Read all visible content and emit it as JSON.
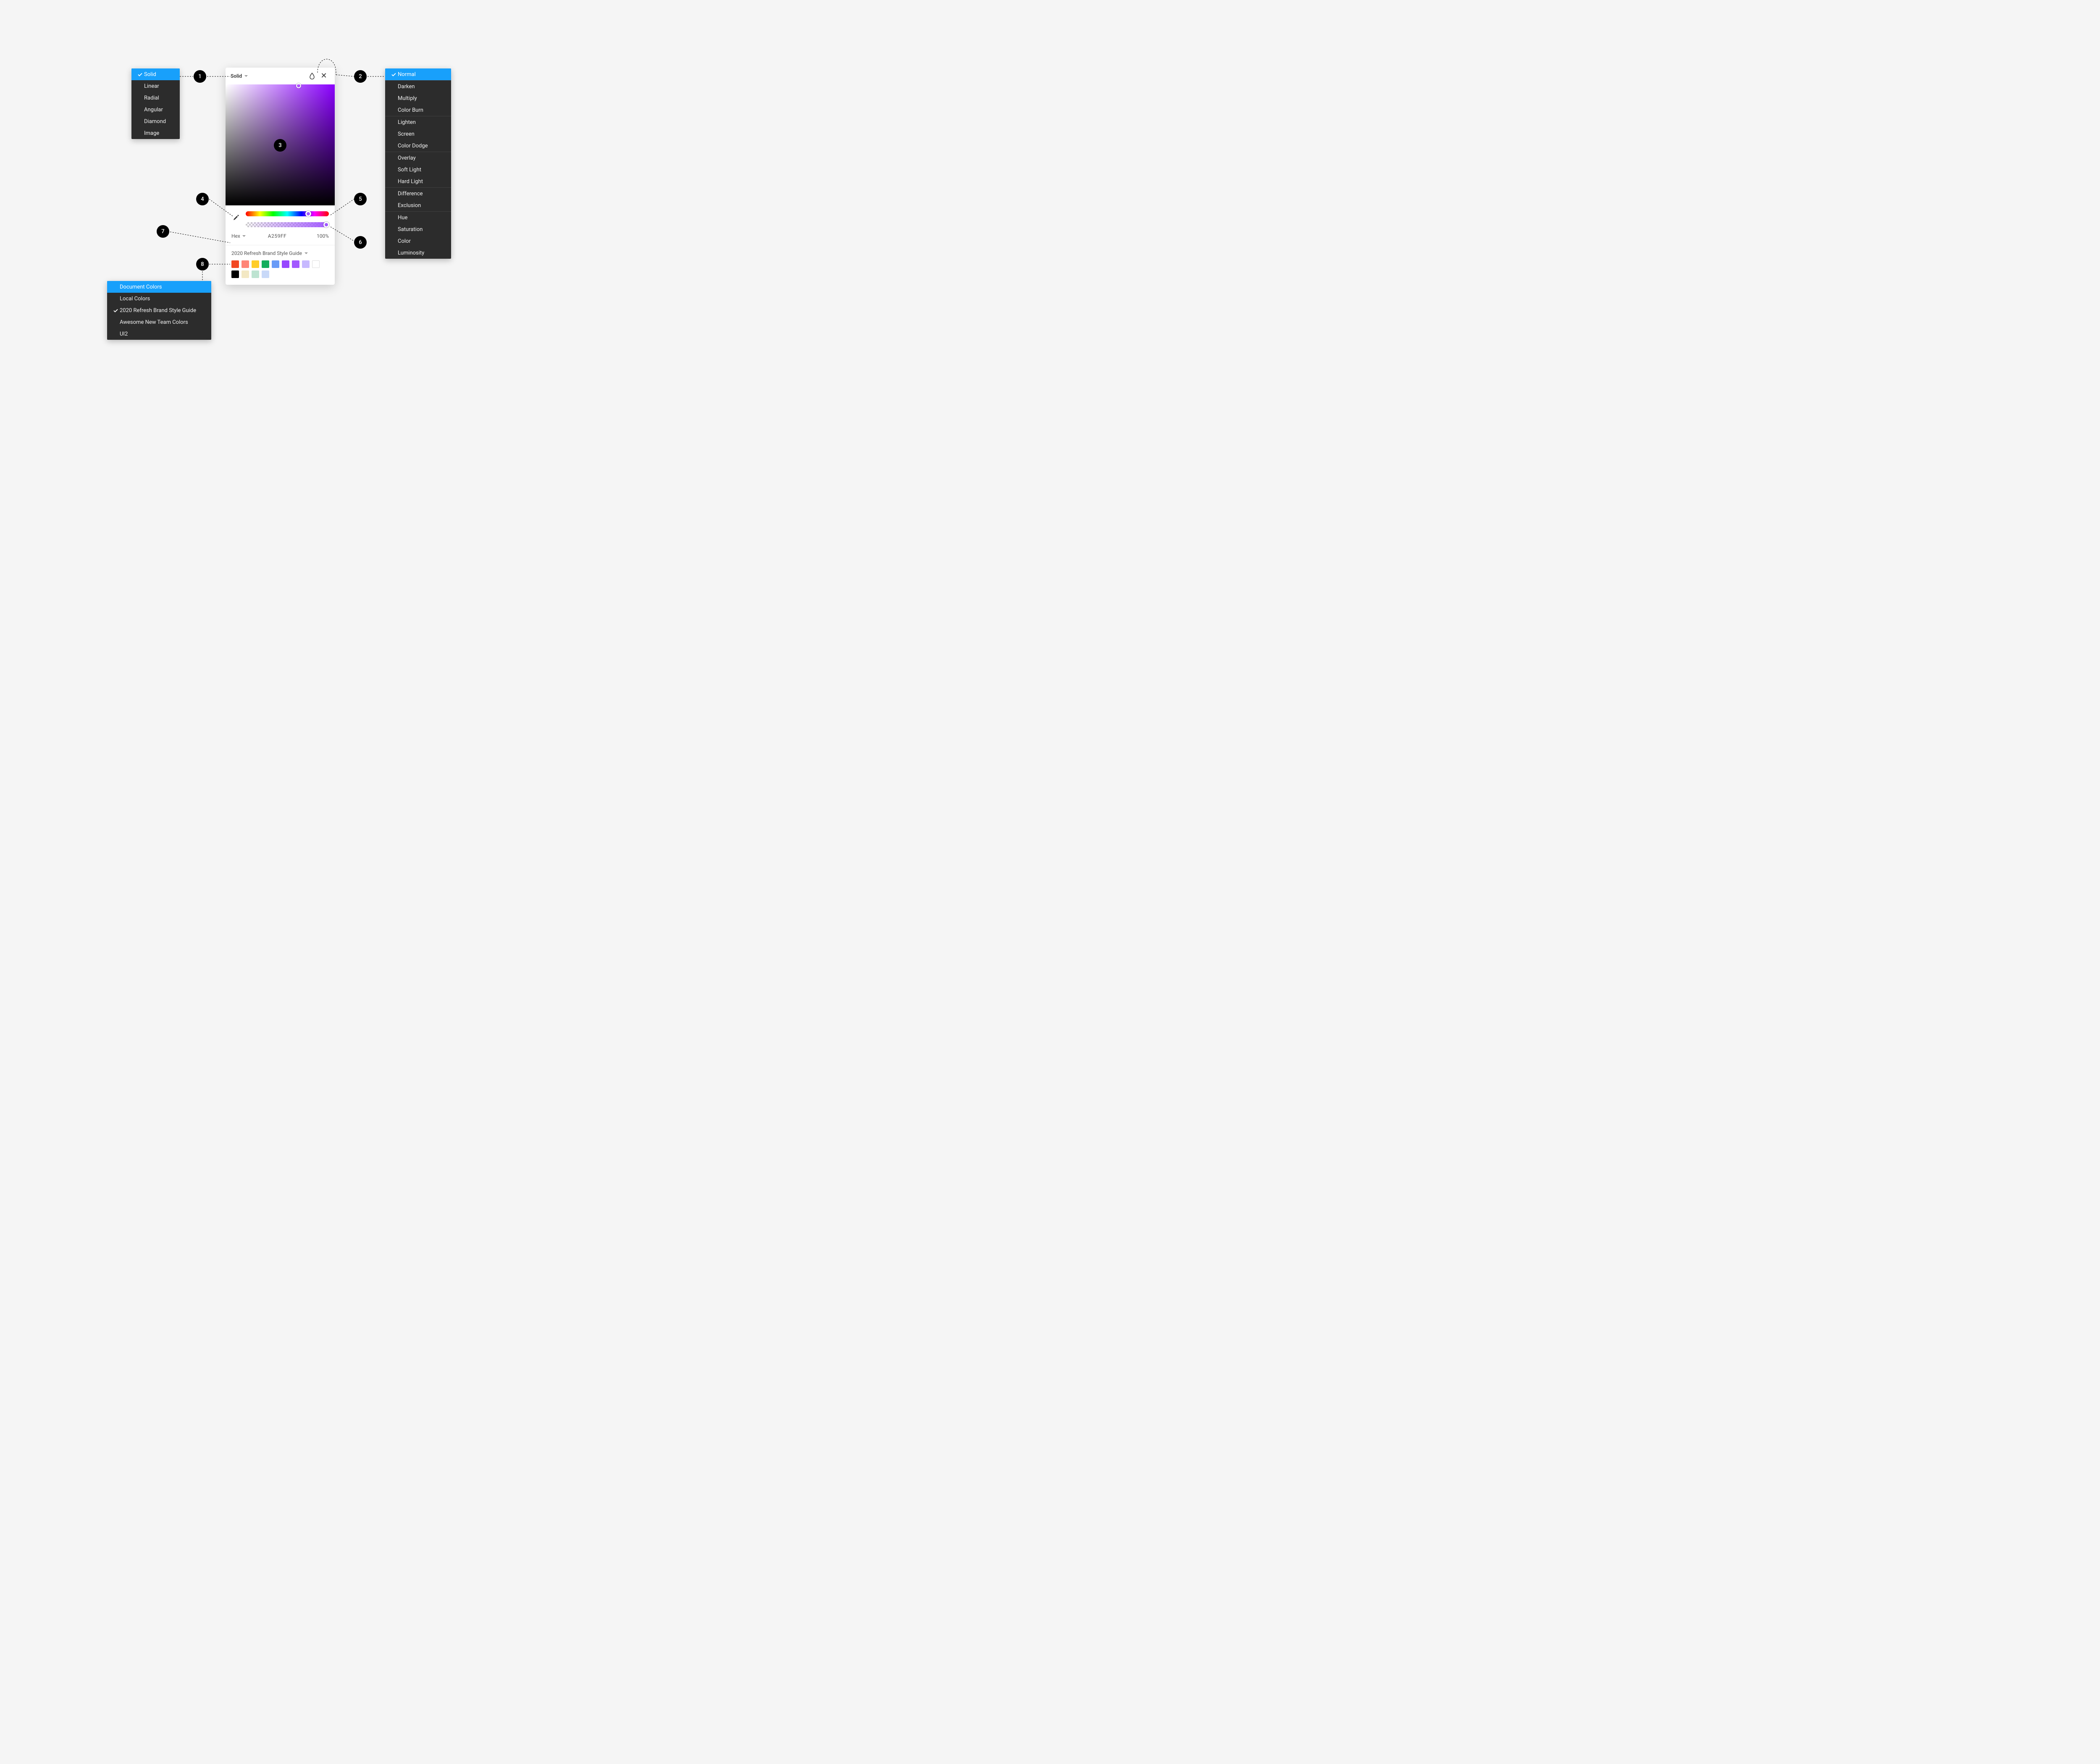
{
  "fillMenu": {
    "items": [
      "Solid",
      "Linear",
      "Radial",
      "Angular",
      "Diamond",
      "Image"
    ],
    "selectedIndex": 0
  },
  "blendMenu": {
    "groups": [
      [
        "Normal"
      ],
      [
        "Darken",
        "Multiply",
        "Color Burn"
      ],
      [
        "Lighten",
        "Screen",
        "Color Dodge"
      ],
      [
        "Overlay",
        "Soft Light",
        "Hard Light"
      ],
      [
        "Difference",
        "Exclusion"
      ],
      [
        "Hue",
        "Saturation",
        "Color",
        "Luminosity"
      ]
    ],
    "selected": "Normal"
  },
  "paletteMenu": {
    "items": [
      "Document Colors",
      "Local Colors",
      "2020 Refresh Brand Style Guide",
      "Awesome New Team Colors",
      "UI2"
    ],
    "hoveredIndex": 0,
    "checkedIndex": 2
  },
  "picker": {
    "mode": "Solid",
    "colorModeLabel": "Hex",
    "hex": "A259FF",
    "alpha": "100%",
    "libraryLabel": "2020 Refresh Brand Style Guide",
    "swatches": [
      "#F24822",
      "#FF8577",
      "#FFCD29",
      "#14AE5C",
      "#699BF7",
      "#9747FF",
      "#A259FF",
      "#C7B9FF",
      "#FFFFFF",
      "#000000",
      "#F3E8C4",
      "#BDE3D1",
      "#C9D9F8"
    ]
  },
  "callouts": [
    "1",
    "2",
    "3",
    "4",
    "5",
    "6",
    "7",
    "8"
  ]
}
